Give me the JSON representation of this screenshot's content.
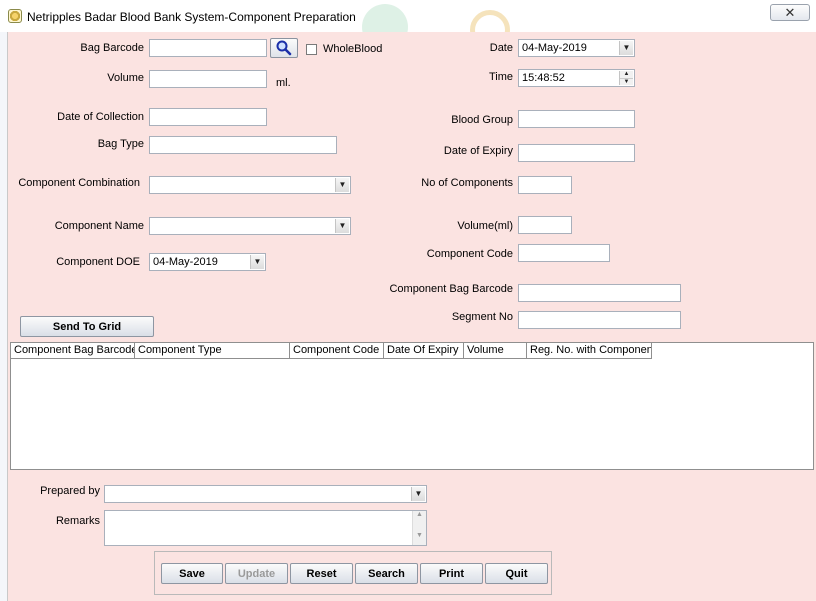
{
  "window": {
    "title": "Netripples Badar Blood Bank System-Component Preparation",
    "close_glyph": "✕"
  },
  "form": {
    "bag_barcode": {
      "label": "Bag Barcode",
      "value": ""
    },
    "whole_blood": {
      "label": "WholeBlood",
      "checked": false
    },
    "date": {
      "label": "Date",
      "value": "04-May-2019"
    },
    "volume": {
      "label": "Volume",
      "value": "",
      "unit": "ml."
    },
    "time": {
      "label": "Time",
      "value": "15:48:52"
    },
    "date_of_collection": {
      "label": "Date of Collection",
      "value": ""
    },
    "blood_group": {
      "label": "Blood Group",
      "value": ""
    },
    "bag_type": {
      "label": "Bag Type",
      "value": ""
    },
    "date_of_expiry": {
      "label": "Date of Expiry",
      "value": ""
    },
    "component_combination": {
      "label": "Component Combination",
      "value": ""
    },
    "no_of_components": {
      "label": "No of Components",
      "value": ""
    },
    "component_name": {
      "label": "Component Name",
      "value": ""
    },
    "volume_ml": {
      "label": "Volume(ml)",
      "value": ""
    },
    "component_code": {
      "label": "Component Code",
      "value": ""
    },
    "component_doe": {
      "label": "Component DOE",
      "value": "04-May-2019"
    },
    "component_bag_barcode": {
      "label": "Component Bag Barcode",
      "value": ""
    },
    "segment_no": {
      "label": "Segment No",
      "value": ""
    },
    "send_to_grid": "Send To Grid"
  },
  "grid": {
    "columns": [
      "Component Bag Barcode",
      "Component Type",
      "Component Code",
      "Date Of Expiry",
      "Volume",
      "Reg. No. with Component"
    ],
    "rows": []
  },
  "footer": {
    "prepared_by": {
      "label": "Prepared by",
      "value": ""
    },
    "remarks": {
      "label": "Remarks",
      "value": ""
    }
  },
  "actions": {
    "save": "Save",
    "update": "Update",
    "reset": "Reset",
    "search": "Search",
    "print": "Print",
    "quit": "Quit"
  },
  "icons": {
    "app": "blood-bank-app-icon",
    "search": "magnifier-icon",
    "dropdown": "chevron-down-icon",
    "spin": "spinner-icon"
  },
  "colors": {
    "form_background": "#fbe3e1",
    "titlebar_background": "#ffffff"
  }
}
